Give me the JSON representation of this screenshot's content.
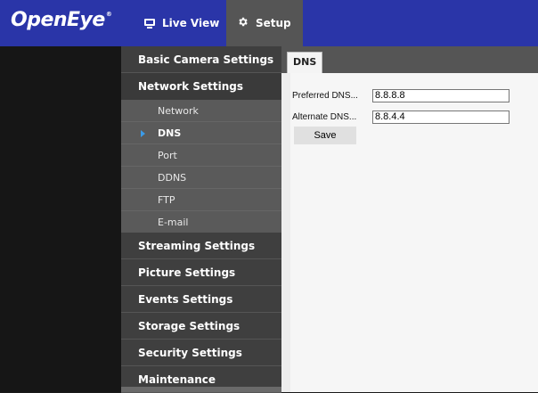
{
  "brand": {
    "logo_text": "OpenEye",
    "logo_mark": "®"
  },
  "topnav": {
    "live_view_label": "Live View",
    "live_view_icon": "monitor-icon",
    "setup_label": "Setup",
    "setup_icon": "gear-icon"
  },
  "sidebar": {
    "sections": [
      {
        "label": "Basic Camera Settings"
      },
      {
        "label": "Network Settings",
        "expanded": true,
        "items": [
          {
            "label": "Network"
          },
          {
            "label": "DNS",
            "active": true
          },
          {
            "label": "Port"
          },
          {
            "label": "DDNS"
          },
          {
            "label": "FTP"
          },
          {
            "label": "E-mail"
          }
        ]
      },
      {
        "label": "Streaming Settings"
      },
      {
        "label": "Picture Settings"
      },
      {
        "label": "Events Settings"
      },
      {
        "label": "Storage Settings"
      },
      {
        "label": "Security Settings"
      },
      {
        "label": "Maintenance"
      }
    ]
  },
  "content": {
    "tab_label": "DNS",
    "fields": [
      {
        "label": "Preferred DNS...",
        "value": "8.8.8.8"
      },
      {
        "label": "Alternate DNS...",
        "value": "8.8.4.4"
      }
    ],
    "save_label": "Save"
  },
  "colors": {
    "topbar": "#2a35a8",
    "active_arrow": "#3b9be8"
  }
}
